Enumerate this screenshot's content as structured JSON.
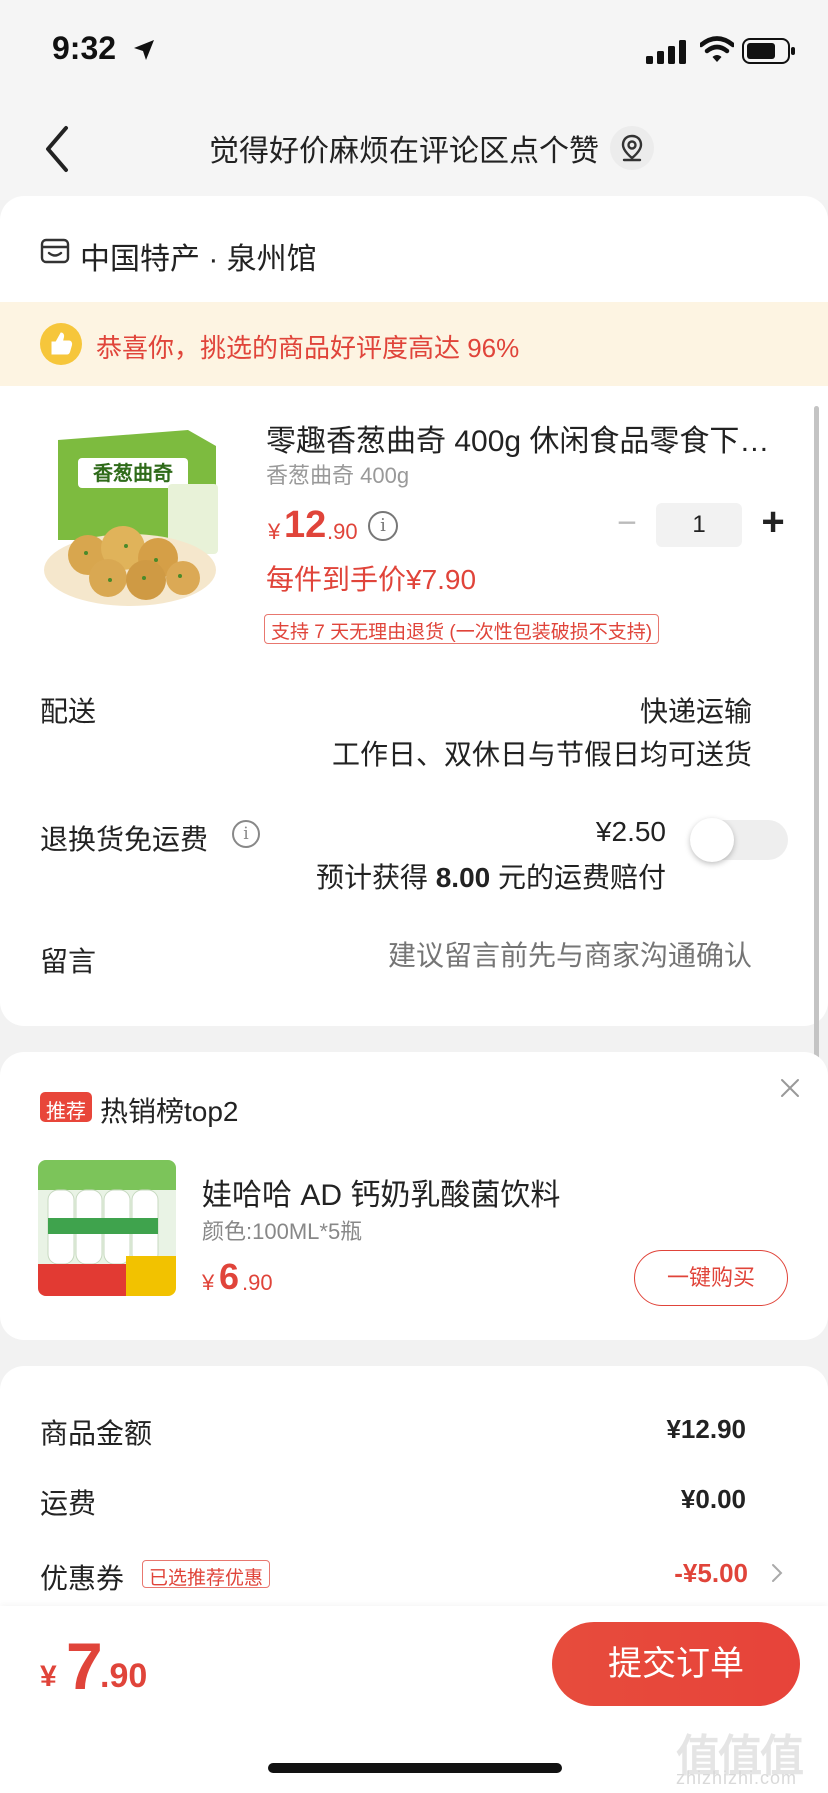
{
  "status": {
    "time": "9:32"
  },
  "nav": {
    "title": "觉得好价麻烦在评论区点个赞"
  },
  "store": {
    "name": "中国特产 · 泉州馆"
  },
  "praise": {
    "text": "恭喜你，挑选的商品好评度高达 96%"
  },
  "product": {
    "title": "零趣香葱曲奇 400g 休闲食品零食下午…",
    "spec": "香葱曲奇 400g",
    "price_yen": "¥",
    "price_int": "12",
    "price_dec": ".90",
    "quantity": "1",
    "per_price": "每件到手价¥7.90",
    "return_tag": "支持 7 天无理由退货 (一次性包装破损不支持)",
    "image_text": "香葱曲奇"
  },
  "delivery": {
    "label": "配送",
    "method": "快递运输",
    "schedule": "工作日、双休日与节假日均可送货"
  },
  "return_shipping": {
    "label": "退换货免运费",
    "fee": "¥2.50",
    "comp_prefix": "预计获得 ",
    "comp_amount": "8.00",
    "comp_suffix": " 元的运费赔付",
    "enabled": false
  },
  "message": {
    "label": "留言",
    "placeholder": "建议留言前先与商家沟通确认"
  },
  "recommend": {
    "badge": "推荐",
    "title": "热销榜top2",
    "name": "娃哈哈 AD 钙奶乳酸菌饮料",
    "spec": "颜色:100ML*5瓶",
    "price_yen": "¥",
    "price_int": "6",
    "price_dec": ".90",
    "button": "一键购买"
  },
  "summary": {
    "goods_label": "商品金额",
    "goods_value": "¥12.90",
    "ship_label": "运费",
    "ship_value": "¥0.00",
    "coupon_label": "优惠券",
    "coupon_tag": "已选推荐优惠",
    "coupon_value": "-¥5.00"
  },
  "footer": {
    "total_yen": "¥",
    "total_int": "7",
    "total_dec": ".90",
    "submit": "提交订单",
    "watermark": "值值值",
    "watermark_sub": "zhizhizhi.com"
  },
  "colors": {
    "accent": "#e0443a",
    "praise_bg": "#fdf4e2",
    "thumb": "#f6c63b"
  }
}
